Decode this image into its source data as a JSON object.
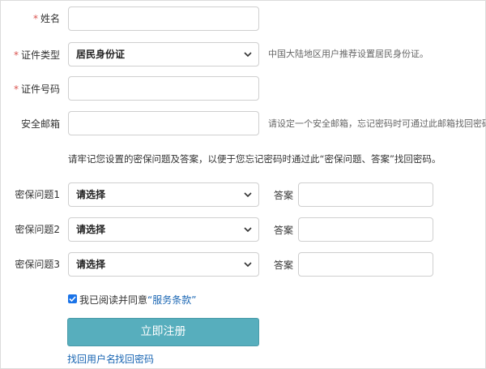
{
  "form": {
    "name": {
      "required_mark": "*",
      "label": "姓名",
      "value": ""
    },
    "id_type": {
      "required_mark": "*",
      "label": "证件类型",
      "selected": "居民身份证",
      "hint": "中国大陆地区用户推荐设置居民身份证。"
    },
    "id_number": {
      "required_mark": "*",
      "label": "证件号码",
      "value": ""
    },
    "email": {
      "label": "安全邮箱",
      "value": "",
      "hint": "请设定一个安全邮箱，忘记密码时可通过此邮箱找回密码。"
    },
    "security_note": "请牢记您设置的密保问题及答案，以便于您忘记密码时通过此“密保问题、答案”找回密码。",
    "questions": [
      {
        "label": "密保问题1",
        "selected": "请选择",
        "answer_label": "答案",
        "answer": ""
      },
      {
        "label": "密保问题2",
        "selected": "请选择",
        "answer_label": "答案",
        "answer": ""
      },
      {
        "label": "密保问题3",
        "selected": "请选择",
        "answer_label": "答案",
        "answer": ""
      }
    ],
    "agree": {
      "checked": true,
      "text": "我已阅读并同意",
      "terms": "“服务条款”"
    },
    "submit_label": "立即注册",
    "links": {
      "find_username": "找回用户名",
      "find_password": "找回密码"
    }
  },
  "colors": {
    "accent": "#57aebd",
    "required": "#d9534f",
    "link": "#1a66b3",
    "checkbox": "#1a73e8"
  }
}
